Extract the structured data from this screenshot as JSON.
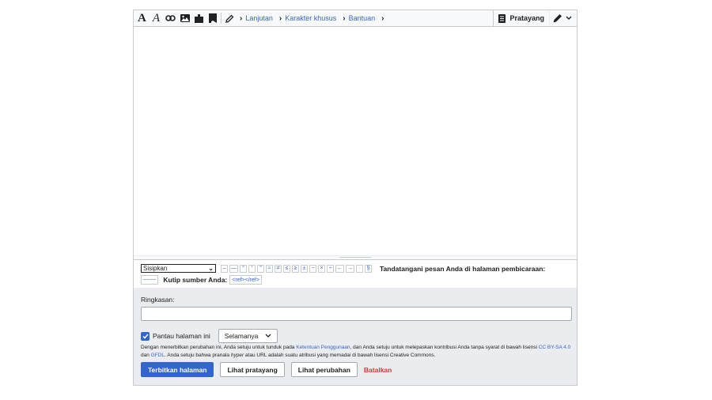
{
  "toolbar": {
    "bold_label": "A",
    "italic_label": "A",
    "tabs": [
      {
        "label": "Lanjutan"
      },
      {
        "label": "Karakter khusus"
      },
      {
        "label": "Bantuan"
      }
    ],
    "preview_label": "Pratayang"
  },
  "charinsert": {
    "select_value": "Sisipkan",
    "chars": [
      "–",
      "—",
      "°",
      "′",
      "″",
      "≈",
      "≠",
      "≤",
      "≥",
      "±",
      "−",
      "×",
      "÷",
      "←",
      "→",
      "·",
      "§"
    ],
    "sign_label": "Tandatangani pesan Anda di halaman pembicaraan:",
    "sign_token": "~~~~",
    "cite_label": "Kutip sumber Anda:",
    "cite_token": "<ref></ref>"
  },
  "summary": {
    "label": "Ringkasan:",
    "value": ""
  },
  "watch": {
    "label": "Pantau halaman ini",
    "period": "Selamanya"
  },
  "legal": {
    "p1": "Dengan menerbitkan perubahan ini, Anda setuju untuk tunduk pada ",
    "terms_link": "Ketentuan Penggunaan",
    "p2": ", dan Anda setuju untuk melepaskan kontribusi Anda tanpa syarat di bawah lisensi ",
    "cc_link": "CC BY-SA 4.0",
    "p3": " dan ",
    "gfdl_link": "GFDL",
    "p4": ". Anda setuju bahwa pranala ",
    "hyper": "hyper",
    "p5": " atau URL adalah suatu atribusi yang memadai di bawah lisensi Creative Commons."
  },
  "actions": {
    "publish": "Terbitkan halaman",
    "preview": "Lihat pratayang",
    "diff": "Lihat perubahan",
    "cancel": "Batalkan"
  },
  "colors": {
    "accent": "#3366cc",
    "destructive": "#dd3333",
    "border": "#c8ccd1",
    "panel": "#eaecf0"
  }
}
